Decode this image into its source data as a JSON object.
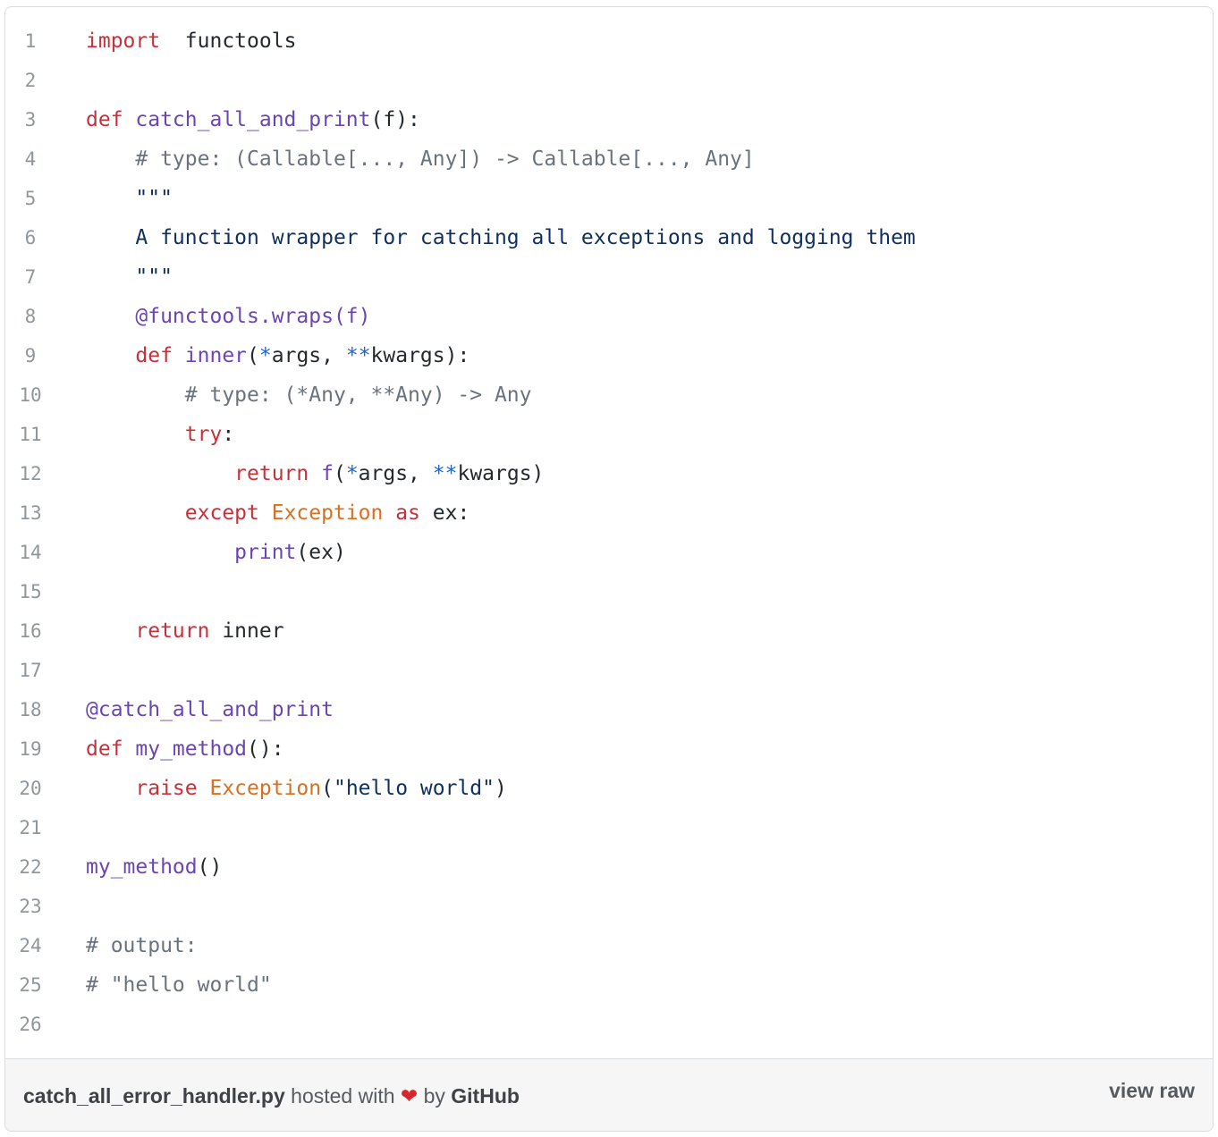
{
  "gist": {
    "lines": [
      {
        "n": "1",
        "segs": [
          [
            "kw",
            "import"
          ],
          [
            "",
            "  functools"
          ]
        ]
      },
      {
        "n": "2",
        "segs": []
      },
      {
        "n": "3",
        "segs": [
          [
            "kw",
            "def"
          ],
          [
            "",
            ""
          ],
          [
            "fn",
            " catch_all_and_print"
          ],
          [
            "",
            "(f):"
          ]
        ]
      },
      {
        "n": "4",
        "segs": [
          [
            "cm",
            "    # type: (Callable[..., Any]) -> Callable[..., Any]"
          ]
        ]
      },
      {
        "n": "5",
        "segs": [
          [
            "str",
            "    \"\"\""
          ]
        ]
      },
      {
        "n": "6",
        "segs": [
          [
            "str",
            "    A function wrapper for catching all exceptions and logging them"
          ]
        ]
      },
      {
        "n": "7",
        "segs": [
          [
            "str",
            "    \"\"\""
          ]
        ]
      },
      {
        "n": "8",
        "segs": [
          [
            "fn",
            "    @functools.wraps(f)"
          ]
        ]
      },
      {
        "n": "9",
        "segs": [
          [
            "kw",
            "    def"
          ],
          [
            "fn",
            " inner"
          ],
          [
            "",
            "("
          ],
          [
            "op",
            "*"
          ],
          [
            "",
            "args, "
          ],
          [
            "op",
            "**"
          ],
          [
            "",
            "kwargs):"
          ]
        ]
      },
      {
        "n": "10",
        "segs": [
          [
            "cm",
            "        # type: (*Any, **Any) -> Any"
          ]
        ]
      },
      {
        "n": "11",
        "segs": [
          [
            "kw",
            "        try"
          ],
          [
            "",
            ":"
          ]
        ]
      },
      {
        "n": "12",
        "segs": [
          [
            "kw",
            "            return"
          ],
          [
            "fn",
            " f"
          ],
          [
            "",
            "("
          ],
          [
            "op",
            "*"
          ],
          [
            "",
            "args, "
          ],
          [
            "op",
            "**"
          ],
          [
            "",
            "kwargs)"
          ]
        ]
      },
      {
        "n": "13",
        "segs": [
          [
            "kw",
            "        except"
          ],
          [
            "cls",
            " Exception"
          ],
          [
            "kw",
            " as"
          ],
          [
            "",
            " ex:"
          ]
        ]
      },
      {
        "n": "14",
        "segs": [
          [
            "fn",
            "            print"
          ],
          [
            "",
            "(ex)"
          ]
        ]
      },
      {
        "n": "15",
        "segs": []
      },
      {
        "n": "16",
        "segs": [
          [
            "kw",
            "    return"
          ],
          [
            "",
            " inner"
          ]
        ]
      },
      {
        "n": "17",
        "segs": []
      },
      {
        "n": "18",
        "segs": [
          [
            "fn",
            "@catch_all_and_print"
          ]
        ]
      },
      {
        "n": "19",
        "segs": [
          [
            "kw",
            "def"
          ],
          [
            "fn",
            " my_method"
          ],
          [
            "",
            "():"
          ]
        ]
      },
      {
        "n": "20",
        "segs": [
          [
            "kw",
            "    raise"
          ],
          [
            "cls",
            " Exception"
          ],
          [
            "",
            "("
          ],
          [
            "str",
            "\"hello world\""
          ],
          [
            "",
            ")"
          ]
        ]
      },
      {
        "n": "21",
        "segs": []
      },
      {
        "n": "22",
        "segs": [
          [
            "fn",
            "my_method"
          ],
          [
            "",
            "()"
          ]
        ]
      },
      {
        "n": "23",
        "segs": []
      },
      {
        "n": "24",
        "segs": [
          [
            "cm",
            "# output:"
          ]
        ]
      },
      {
        "n": "25",
        "segs": [
          [
            "cm",
            "# \"hello world\""
          ]
        ]
      },
      {
        "n": "26",
        "segs": []
      }
    ]
  },
  "footer": {
    "filename": "catch_all_error_handler.py",
    "hosted_text": "hosted with",
    "heart": "❤",
    "by_text": "by",
    "brand": "GitHub",
    "view_raw": "view raw"
  }
}
